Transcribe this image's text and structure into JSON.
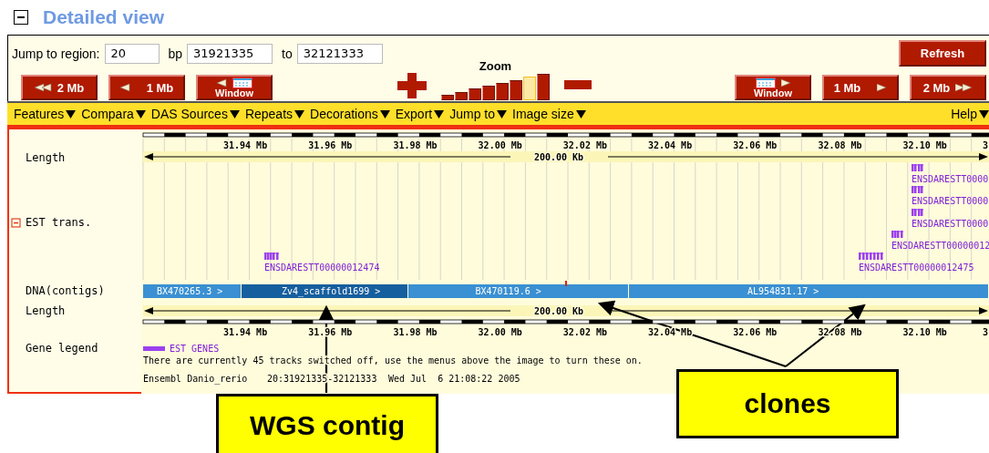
{
  "section": {
    "title": "Detailed view",
    "expanded": true
  },
  "region_form": {
    "label": "Jump to region:",
    "chromosome": "20",
    "bp_label": "bp",
    "start": "31921335",
    "to_label": "to",
    "end": "32121333",
    "refresh": "Refresh"
  },
  "nav_left": [
    {
      "kind": "double",
      "label": "2 Mb"
    },
    {
      "kind": "single",
      "label": "1 Mb"
    },
    {
      "kind": "window",
      "label": "Window"
    }
  ],
  "zoom": {
    "label": "Zoom",
    "steps": [
      {
        "selected": false
      },
      {
        "selected": false
      },
      {
        "selected": false
      },
      {
        "selected": false
      },
      {
        "selected": false
      },
      {
        "selected": false
      },
      {
        "selected": true
      },
      {
        "selected": false
      }
    ]
  },
  "nav_right": [
    {
      "kind": "window",
      "label": "Window"
    },
    {
      "kind": "single",
      "label": "1 Mb"
    },
    {
      "kind": "double",
      "label": "2 Mb"
    }
  ],
  "menu": [
    "Features",
    "Compara",
    "DAS Sources",
    "Repeats",
    "Decorations",
    "Export",
    "Jump to",
    "Image size"
  ],
  "menu_right": "Help",
  "tracks": {
    "top_ruler": [
      "31.94 Mb",
      "31.96 Mb",
      "31.98 Mb",
      "32.00 Mb",
      "32.02 Mb",
      "32.04 Mb",
      "32.06 Mb",
      "32.08 Mb",
      "32.10 Mb",
      "3"
    ],
    "length_label": "Length",
    "length_text": "200.00 Kb",
    "est_label": "EST trans.",
    "est_expanded": true,
    "ests": [
      {
        "label": "ENSDARESTT0000"
      },
      {
        "label": "ENSDARESTT0000"
      },
      {
        "label": "ENSDARESTT0000"
      },
      {
        "label": "ENSDARESTT00000012"
      },
      {
        "label": "ENSDARESTT00000012474"
      },
      {
        "label": "ENSDARESTT00000012475"
      }
    ],
    "contig_label": "DNA(contigs)",
    "contigs": [
      {
        "name": "BX470265.3 >",
        "color": "#3a90d2"
      },
      {
        "name": "Zv4_scaffold1699 >",
        "color": "#165f9e"
      },
      {
        "name": "BX470119.6 >",
        "color": "#3a90d2"
      },
      {
        "name": "AL954831.17 >",
        "color": "#3a90d2"
      }
    ],
    "length2_label": "Length",
    "length2_text": "200.00 Kb",
    "bottom_ruler": [
      "31.94 Mb",
      "31.96 Mb",
      "31.98 Mb",
      "32.00 Mb",
      "32.02 Mb",
      "32.04 Mb",
      "32.06 Mb",
      "32.08 Mb",
      "32.10 Mb",
      "3"
    ],
    "legend_label": "Gene legend",
    "legend_item": "EST GENES",
    "note": "There are currently 45 tracks switched off, use the menus above the image to turn these on.",
    "footer": [
      "Ensembl Danio_rerio",
      "20:31921335-32121333",
      "Wed Jul  6 21:08:22 2005"
    ]
  },
  "callouts": [
    {
      "kind": "wgs",
      "text": "WGS contig"
    },
    {
      "kind": "clones",
      "text": "clones"
    }
  ]
}
